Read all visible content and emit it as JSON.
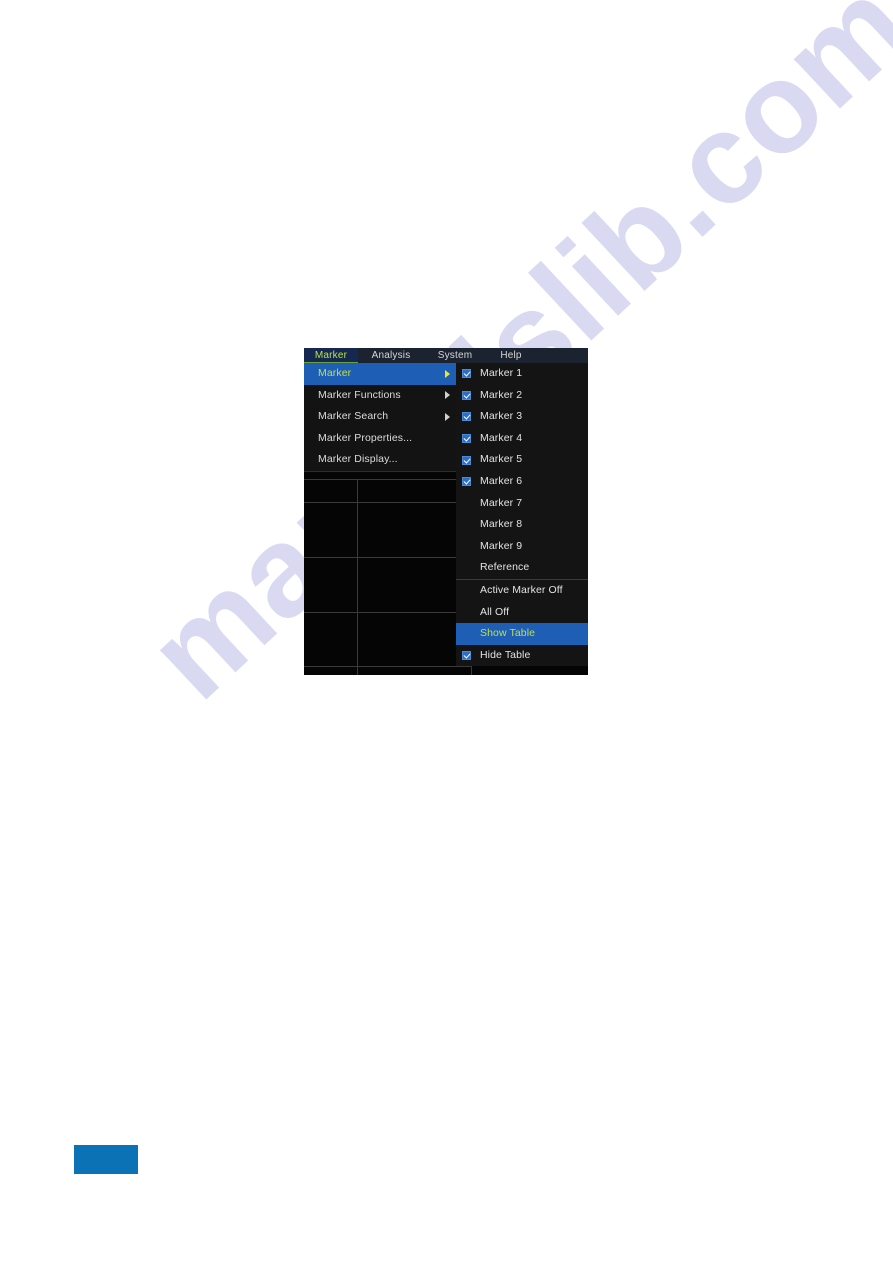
{
  "watermark": {
    "text": "manualslib.com"
  },
  "instrument": {
    "menu_bar": [
      {
        "label": "Marker",
        "active": true
      },
      {
        "label": "Analysis",
        "active": false
      },
      {
        "label": "System",
        "active": false
      },
      {
        "label": "Help",
        "active": false
      }
    ],
    "primary_menu": [
      {
        "label": "Marker",
        "has_submenu": true,
        "selected": true
      },
      {
        "label": "Marker Functions",
        "has_submenu": true,
        "selected": false
      },
      {
        "label": "Marker Search",
        "has_submenu": true,
        "selected": false
      },
      {
        "label": "Marker Properties...",
        "has_submenu": false,
        "selected": false
      },
      {
        "label": "Marker Display...",
        "has_submenu": false,
        "selected": false
      }
    ],
    "secondary_menu": [
      {
        "label": "Marker 1",
        "checked": true,
        "highlighted": false
      },
      {
        "label": "Marker 2",
        "checked": true,
        "highlighted": false
      },
      {
        "label": "Marker 3",
        "checked": true,
        "highlighted": false
      },
      {
        "label": "Marker 4",
        "checked": true,
        "highlighted": false
      },
      {
        "label": "Marker 5",
        "checked": true,
        "highlighted": false
      },
      {
        "label": "Marker 6",
        "checked": true,
        "highlighted": false
      },
      {
        "label": "Marker 7",
        "checked": false,
        "highlighted": false
      },
      {
        "label": "Marker 8",
        "checked": false,
        "highlighted": false
      },
      {
        "label": "Marker 9",
        "checked": false,
        "highlighted": false
      },
      {
        "label": "Reference",
        "checked": false,
        "highlighted": false
      },
      {
        "separator": true
      },
      {
        "label": "Active Marker Off",
        "checked": false,
        "highlighted": false
      },
      {
        "label": "All Off",
        "checked": false,
        "highlighted": false
      },
      {
        "label": "Show Table",
        "checked": false,
        "highlighted": true
      },
      {
        "label": "Hide Table",
        "checked": true,
        "highlighted": false
      }
    ],
    "colors": {
      "menu_highlight": "#1f5eb5",
      "highlight_text": "#bde04e",
      "tab_active_bg": "#16284f",
      "checkbox": "#2c6fc4",
      "trace": "#9a9a2e",
      "page_block": "#0b72b5"
    }
  }
}
